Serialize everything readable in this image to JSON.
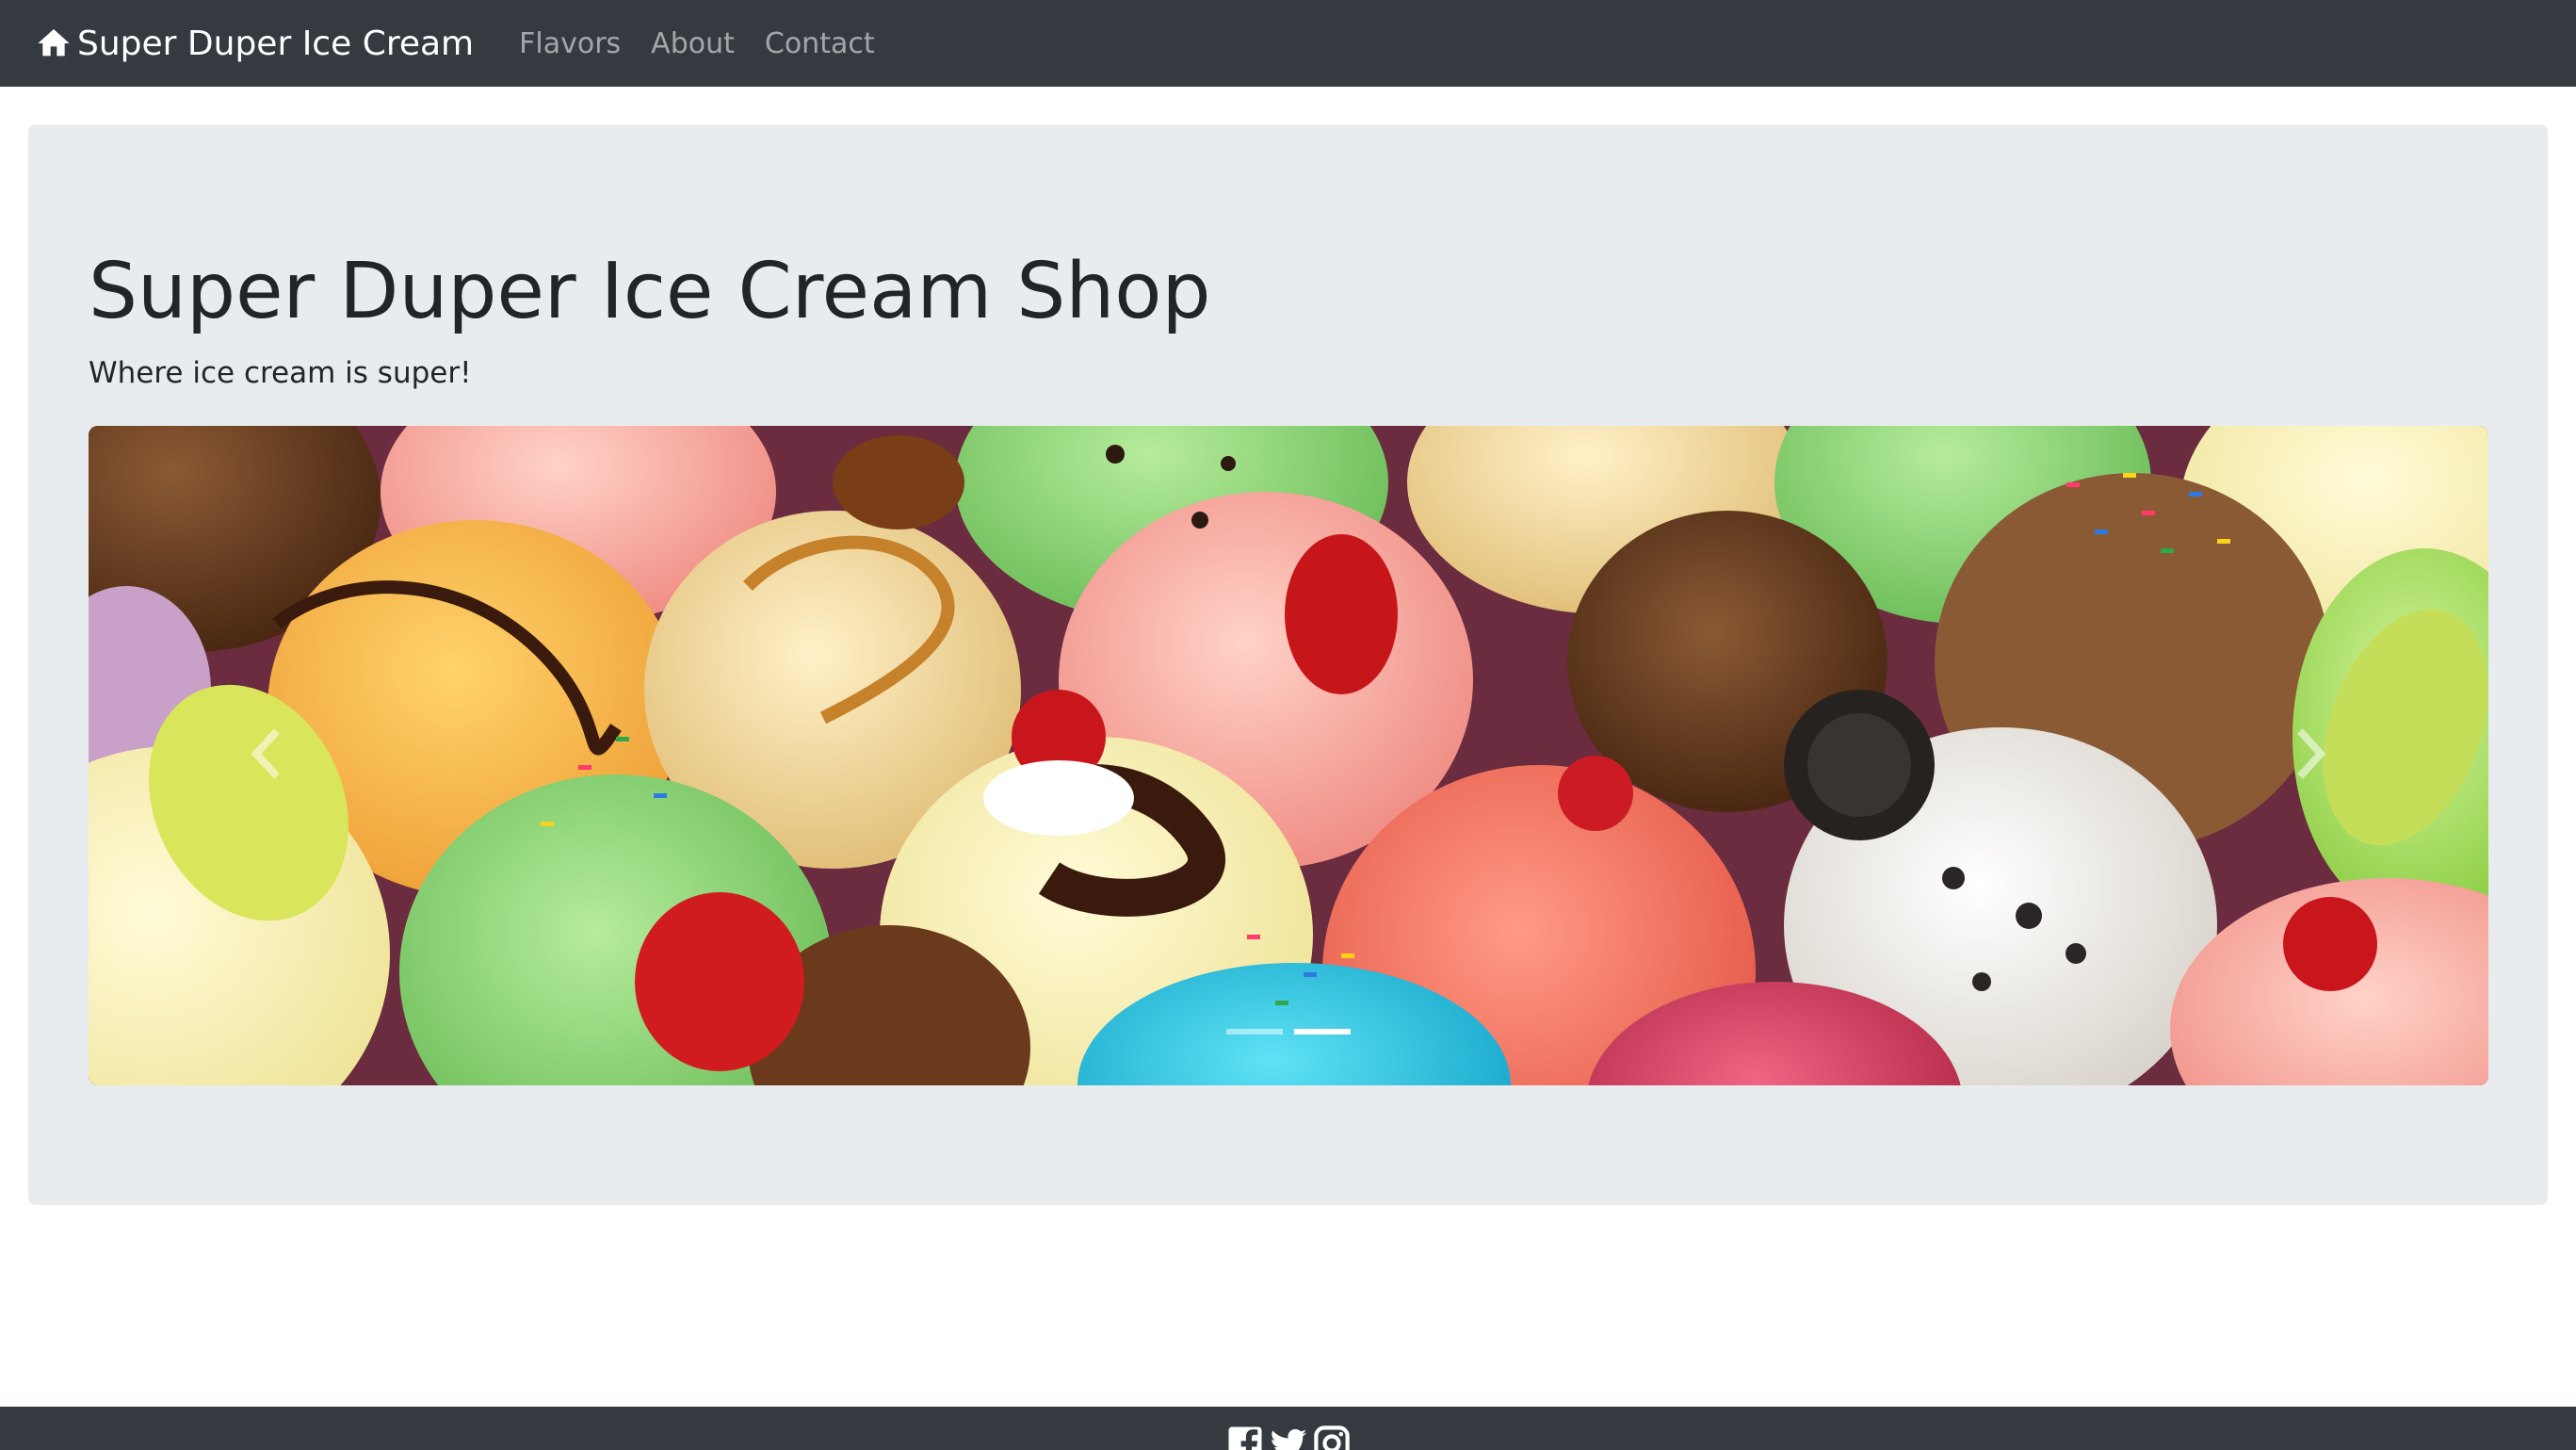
{
  "navbar": {
    "brand": "Super Duper Ice Cream",
    "brand_icon": "home-icon",
    "links": [
      {
        "label": "Flavors"
      },
      {
        "label": "About"
      },
      {
        "label": "Contact"
      }
    ]
  },
  "jumbotron": {
    "title": "Super Duper Ice Cream Shop",
    "tagline": "Where ice cream is super!"
  },
  "carousel": {
    "slide_count": 2,
    "active_index": 1,
    "prev_icon": "chevron-left-icon",
    "next_icon": "chevron-right-icon"
  },
  "footer": {
    "icons": [
      "facebook-icon",
      "twitter-icon",
      "instagram-icon"
    ]
  },
  "colors": {
    "navbar_bg": "#343a40",
    "jumbotron_bg": "#e9ecef",
    "text_dark": "#212529",
    "nav_link": "rgba(255,255,255,0.55)"
  }
}
